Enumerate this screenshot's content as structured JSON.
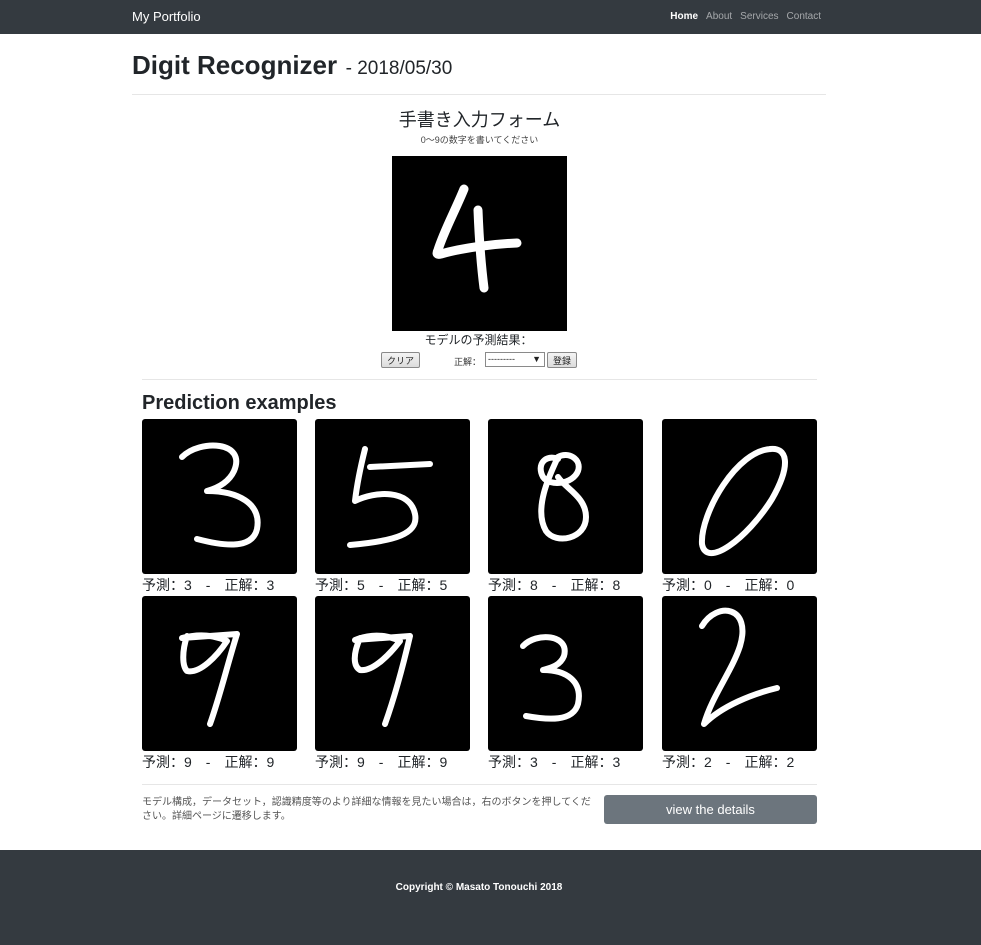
{
  "nav": {
    "brand": "My Portfolio",
    "links": [
      "Home",
      "About",
      "Services",
      "Contact"
    ],
    "active": "Home"
  },
  "header": {
    "title": "Digit Recognizer",
    "date": "- 2018/05/30"
  },
  "form": {
    "title": "手書き入力フォーム",
    "subtitle": "0〜9の数字を書いてください",
    "result_label": "モデルの予測結果：",
    "clear_label": "クリア",
    "answer_label": "正解：",
    "answer_selected": "---------",
    "register_label": "登録"
  },
  "examples": {
    "title": "Prediction examples",
    "items": [
      {
        "caption": "予測：3　-　正解：3"
      },
      {
        "caption": "予測：5　-　正解：5"
      },
      {
        "caption": "予測：8　-　正解：8"
      },
      {
        "caption": "予測：0　-　正解：0"
      },
      {
        "caption": "予測：9　-　正解：9"
      },
      {
        "caption": "予測：9　-　正解：9"
      },
      {
        "caption": "予測：3　-　正解：3"
      },
      {
        "caption": "予測：2　-　正解：2"
      }
    ]
  },
  "details": {
    "text": "モデル構成，データセット，認識精度等のより詳細な情報を見たい場合は，右のボタンを押してください。詳細ページに遷移します。",
    "button_label": "view the details"
  },
  "footer": {
    "copyright": "Copyright © Masato Tonouchi 2018"
  },
  "colors": {
    "navbar": "#343a40",
    "details_button": "#6c757d",
    "canvas": "#000000",
    "stroke": "#ffffff"
  }
}
